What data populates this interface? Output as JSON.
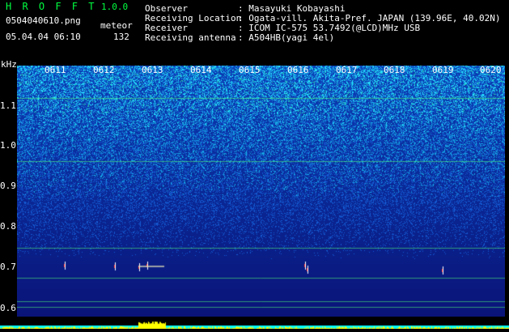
{
  "header": {
    "title": "H R O F F T",
    "version": "1.0.0",
    "filename": "0504040610.png",
    "datetime": "05.04.04 06:10",
    "meteor_label": "meteor",
    "meteor_count": "132"
  },
  "info": [
    {
      "key": "Observer",
      "value": ": Masayuki Kobayashi"
    },
    {
      "key": "Receiving Location",
      "value": ": Ogata-vill. Akita-Pref. JAPAN (139.96E, 40.02N)"
    },
    {
      "key": "Receiver",
      "value": ": ICOM IC-575 53.7492(@LCD)MHz USB"
    },
    {
      "key": "Receiving antenna",
      "value": ": A504HB(yagi 4el)"
    }
  ],
  "axis": {
    "unit": "kHz",
    "yticks": [
      "1.1",
      "1.0",
      "0.9",
      "0.8",
      "0.7",
      "0.6"
    ],
    "times": [
      "0611",
      "0612",
      "0613",
      "0614",
      "0615",
      "0616",
      "0617",
      "0618",
      "0619",
      "0620"
    ]
  },
  "colors": {
    "background": "#000000",
    "title": "#00ff40",
    "spectrum_low": "#0a1a9a",
    "spectrum_high": "#00ffff",
    "meteor": "#ff3030",
    "amplitude": "#ffff00"
  }
}
